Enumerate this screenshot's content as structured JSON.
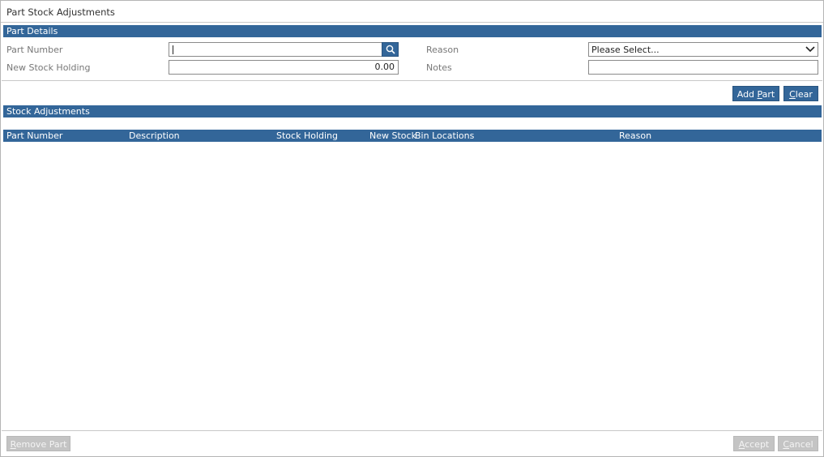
{
  "window": {
    "title": "Part Stock Adjustments"
  },
  "part_details": {
    "section_title": "Part Details",
    "part_number": {
      "label": "Part Number",
      "value": "",
      "placeholder": ""
    },
    "new_stock_holding": {
      "label": "New Stock Holding",
      "value": "0.00"
    },
    "reason": {
      "label": "Reason",
      "selected": "Please Select..."
    },
    "notes": {
      "label": "Notes",
      "value": ""
    }
  },
  "actions": {
    "add_part": {
      "before": "Add ",
      "mnemonic": "P",
      "after": "art"
    },
    "clear": {
      "before": "",
      "mnemonic": "C",
      "after": "lear"
    }
  },
  "stock_adjustments": {
    "section_title": "Stock Adjustments",
    "columns": [
      "Part Number",
      "Description",
      "Stock Holding",
      "New Stock",
      "Bin Locations",
      "Reason"
    ],
    "rows": []
  },
  "footer": {
    "remove_part": {
      "before": "",
      "mnemonic": "R",
      "after": "emove Part"
    },
    "accept": {
      "before": "",
      "mnemonic": "A",
      "after": "ccept"
    },
    "cancel": {
      "before": "",
      "mnemonic": "C",
      "after": "ancel"
    }
  },
  "colors": {
    "accent": "#336699",
    "disabled": "#c4c4c4"
  },
  "icons": {
    "search": "search-icon",
    "dropdown": "chevron-down-icon"
  }
}
